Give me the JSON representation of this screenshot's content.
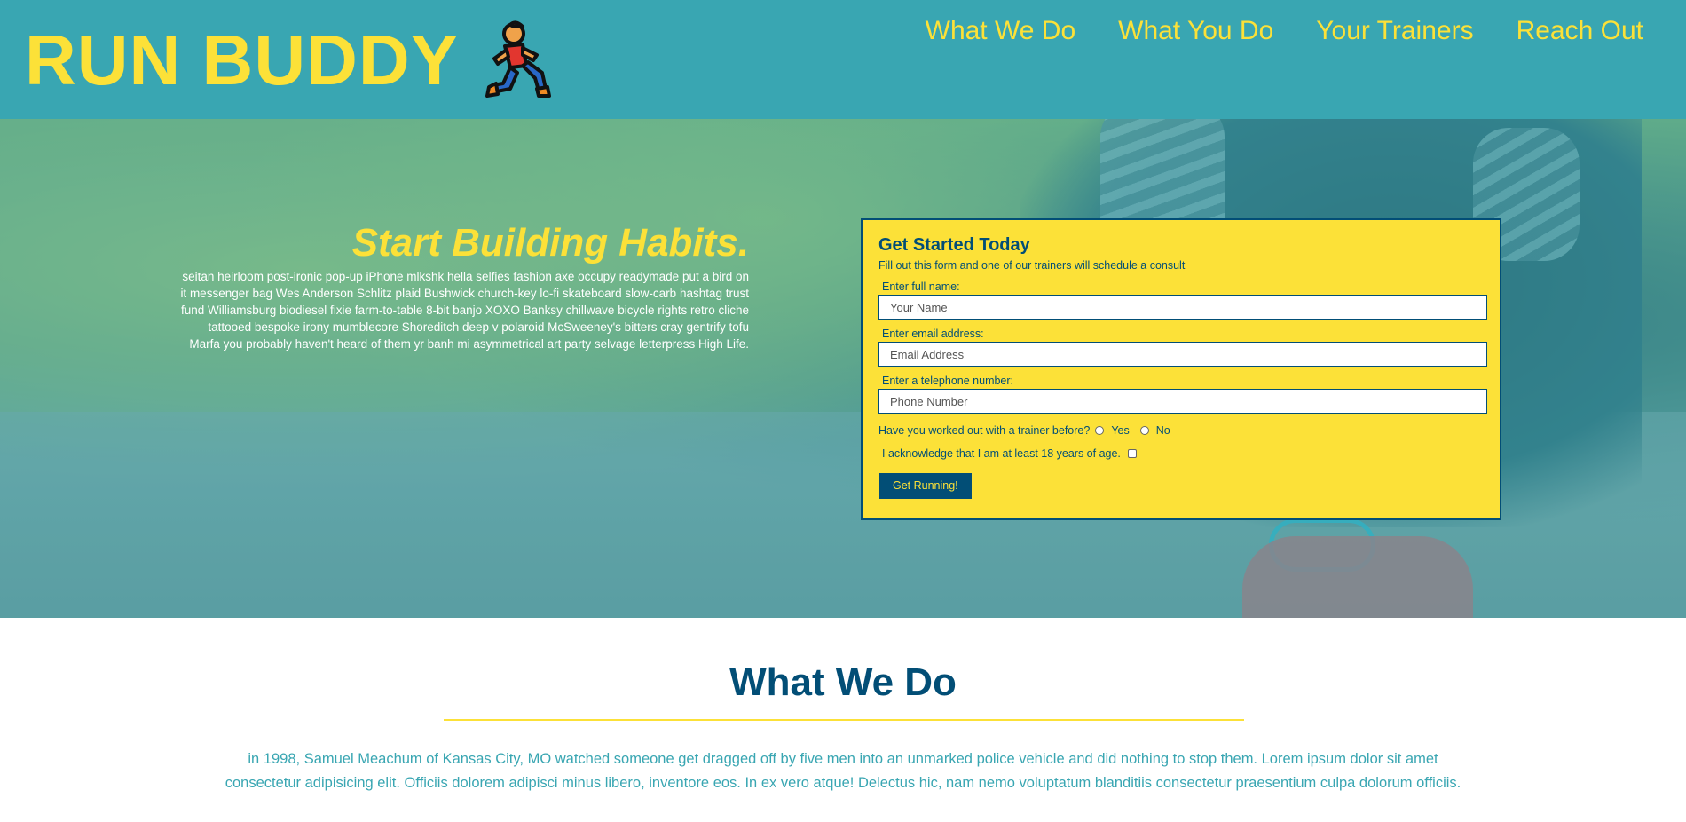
{
  "colors": {
    "primary": "#39a6b2",
    "accent": "#fce138",
    "dark": "#024e76"
  },
  "header": {
    "brand": "RUN BUDDY",
    "brand_icon": "runner-emoji-icon",
    "nav": [
      {
        "label": "What We Do"
      },
      {
        "label": "What You Do"
      },
      {
        "label": "Your Trainers"
      },
      {
        "label": "Reach Out"
      }
    ]
  },
  "hero": {
    "title": "Start Building Habits.",
    "body": "seitan heirloom post-ironic pop-up iPhone mlkshk hella selfies fashion axe occupy readymade put a bird on it messenger bag Wes Anderson Schlitz plaid Bushwick church-key lo-fi skateboard slow-carb hashtag trust fund Williamsburg biodiesel fixie farm-to-table 8-bit banjo XOXO Banksy chillwave bicycle rights retro cliche tattooed bespoke irony mumblecore Shoreditch deep v polaroid McSweeney's bitters cray gentrify tofu Marfa you probably haven't heard of them yr banh mi asymmetrical art party selvage letterpress High Life."
  },
  "form": {
    "title": "Get Started Today",
    "subtitle": "Fill out this form and one of our trainers will schedule a consult",
    "name_label": "Enter full name:",
    "name_placeholder": "Your Name",
    "email_label": "Enter email address:",
    "email_placeholder": "Email Address",
    "phone_label": "Enter a telephone number:",
    "phone_placeholder": "Phone Number",
    "trainer_question": "Have you worked out with a trainer before?",
    "yes_label": "Yes",
    "no_label": "No",
    "age_ack": "I acknowledge that I am at least 18 years of age.",
    "submit_label": "Get Running!"
  },
  "what_we_do": {
    "title": "What We Do",
    "body": "in 1998, Samuel Meachum of Kansas City, MO watched someone get dragged off by five men into an unmarked police vehicle and did nothing to stop them. Lorem ipsum dolor sit amet consectetur adipisicing elit. Officiis dolorem adipisci minus libero, inventore eos. In ex vero atque! Delectus hic, nam nemo voluptatum blanditiis consectetur praesentium culpa dolorum officiis."
  }
}
